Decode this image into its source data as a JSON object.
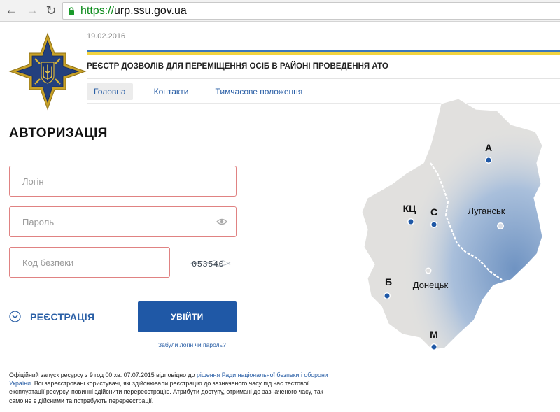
{
  "browser": {
    "url_scheme": "https://",
    "url_host": "urp.ssu.gov.ua"
  },
  "header": {
    "date": "19.02.2016",
    "title": "РЕЄСТР ДОЗВОЛІВ ДЛЯ ПЕРЕМІЩЕННЯ ОСІБ В РАЙОНІ ПРОВЕДЕННЯ АТО",
    "menu": [
      {
        "label": "Головна",
        "active": true
      },
      {
        "label": "Контакти",
        "active": false
      },
      {
        "label": "Тимчасове положення",
        "active": false
      }
    ]
  },
  "auth": {
    "title": "АВТОРИЗАЦІЯ",
    "login_placeholder": "Логін",
    "password_placeholder": "Пароль",
    "code_placeholder": "Код безпеки",
    "captcha_text": "053540",
    "register_label": "РЕЄСТРАЦІЯ",
    "login_button": "УВІЙТИ",
    "forgot_link": "Забули логін чи пароль?"
  },
  "map": {
    "labels": {
      "a": "А",
      "kc": "КЦ",
      "s": "С",
      "luhansk": "Луганськ",
      "donetsk": "Донецьк",
      "b": "Б",
      "m": "М"
    }
  },
  "notice": {
    "text_before": "Офіційний запуск ресурсу з 9 год 00 хв. 07.07.2015 відповідно до ",
    "link_text": "рішення Ради національної безпеки і оборони України",
    "text_after": ". Всі зареєстровані користувачі, які здійснювали реєстрацію до зазначеного часу під час тестової експлуатації ресурсу, повинні здійснити перереєстрацію. Атрибути доступу, отримані до зазначеного часу, так само не є дійсними та потребують перереєстрації."
  },
  "colors": {
    "accent": "#1f58a6",
    "field_border": "#e08282",
    "flag_blue": "#3b77bc",
    "flag_yellow": "#f2d33f"
  },
  "icons": [
    "back-icon",
    "forward-icon",
    "reload-icon",
    "lock-icon",
    "eye-icon",
    "chevron-circle-icon",
    "ssu-emblem"
  ]
}
